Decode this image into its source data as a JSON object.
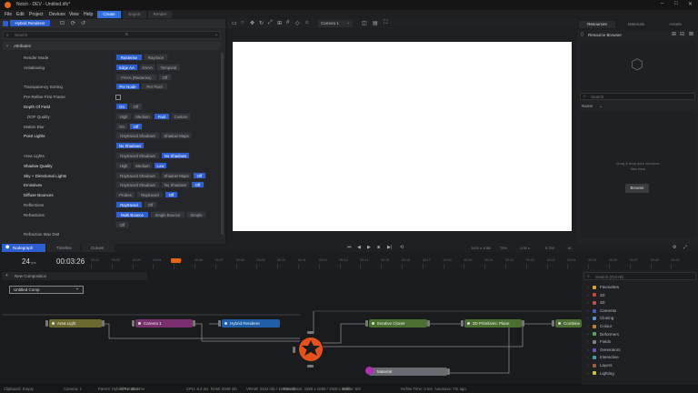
{
  "app": {
    "title": "Notch - DEV - Untitled.dfx*"
  },
  "menu": [
    "File",
    "Edit",
    "Project",
    "Devices",
    "View",
    "Help"
  ],
  "mode_tabs": [
    "Create",
    "Export",
    "Render"
  ],
  "left_panel": {
    "selector": "Hybrid Renderer",
    "search_placeholder": "Search",
    "section": "Attributes",
    "rows": [
      {
        "label": "Render Mode",
        "options": [
          "Rasterise",
          "Raytrace"
        ],
        "active": 0
      },
      {
        "label": "Antialiasing",
        "options": [
          "Edge AA",
          "SSAA",
          "Temporal"
        ],
        "active": 0
      },
      {
        "label": "",
        "options": [
          "FXAA (Rasterise)",
          "Off"
        ],
        "active": -1
      },
      {
        "label": "Transparency Sorting",
        "options": [
          "Per Node",
          "Per Pixel"
        ],
        "active": 0
      },
      {
        "label": "Pre-Refine First Frame",
        "options": [],
        "active": -1
      },
      {
        "label": "Depth Of Field",
        "options": [
          "On",
          "Off"
        ],
        "active": 0
      },
      {
        "label": "DOF Quality",
        "options": [
          "High",
          "Medium",
          "Fast",
          "Custom"
        ],
        "active": 2
      },
      {
        "label": "Motion Blur",
        "options": [
          "On",
          "Off"
        ],
        "active": 1
      },
      {
        "label": "Point Lights",
        "options": [
          "Raytraced Shadows",
          "Shadow Maps"
        ],
        "active": -1
      },
      {
        "label": "",
        "options": [
          "No Shadows"
        ],
        "active": 0
      },
      {
        "label": "Area Lights",
        "options": [
          "Raytraced Shadows",
          "No Shadows"
        ],
        "active": 1
      },
      {
        "label": "Shadow Quality",
        "options": [
          "High",
          "Medium",
          "Low"
        ],
        "active": 2
      },
      {
        "label": "Sky + Directional Lights",
        "options": [
          "Raytraced Shadows",
          "Shadow Maps",
          "Off"
        ],
        "active": 2
      },
      {
        "label": "Emissives",
        "options": [
          "Raytraced Shadows",
          "No Shadows",
          "Off"
        ],
        "active": 2
      },
      {
        "label": "Diffuse Bounces",
        "options": [
          "Probes",
          "Raytraced",
          "Off"
        ],
        "active": 2
      },
      {
        "label": "Reflections",
        "options": [
          "Raytraced",
          "Off"
        ],
        "active": 0
      },
      {
        "label": "Refractions",
        "options": [
          "Multi Bounce",
          "Single Bounce",
          "Simple"
        ],
        "active": 0
      },
      {
        "label": "",
        "options": [
          "Off"
        ],
        "active": -1
      },
      {
        "label": "Refraction Max Dist",
        "options": [],
        "active": -1
      }
    ]
  },
  "viewport": {
    "camera_label": "Camera 1"
  },
  "right_panel": {
    "tabs": [
      "Resources",
      "Materials",
      "Assets"
    ],
    "title": "Resource Browser",
    "search_placeholder": "Search",
    "column": "Name",
    "drop_hint": "Drag & drop your resource files here",
    "browse_button": "Browse"
  },
  "timeline_tabs": [
    "Nodegraph",
    "Timeline",
    "Curves"
  ],
  "transport": {
    "fps": "24",
    "fps_unit": "fps",
    "timecode": "00:03:26",
    "resolution": "1920 x 1080",
    "zoom_left": "75%",
    "zoom_right": "1.00 x",
    "speed": "1",
    "fps_right": "5.750",
    "fps_right2": "60"
  },
  "timeline_ticks": [
    "00:01",
    "00:02",
    "00:03",
    "00:04",
    "00:05",
    "00:06",
    "00:07",
    "00:08",
    "00:09",
    "00:10",
    "00:11",
    "00:12",
    "00:13",
    "00:14",
    "00:15",
    "00:16",
    "00:17",
    "00:18",
    "00:19",
    "00:20",
    "00:21",
    "00:22",
    "00:23",
    "00:24",
    "00:25",
    "00:26",
    "00:27",
    "00:28",
    "00:29"
  ],
  "graph": {
    "new_composition": "New Composition",
    "comp_name": "Untitled Comp",
    "nodes": [
      {
        "label": "Area Light",
        "color": "#6b6a2e"
      },
      {
        "label": "Camera 1",
        "color": "#7a2f6e"
      },
      {
        "label": "Hybrid Renderer",
        "color": "#1f5fa8"
      },
      {
        "label": "Iterative Cloner",
        "color": "#4a7030"
      },
      {
        "label": "3D Primitives: Plane",
        "color": "#4a7030"
      },
      {
        "label": "Combine",
        "color": "#4a7030"
      },
      {
        "label": "Material",
        "color": "#6a6b70"
      }
    ]
  },
  "library": {
    "search_placeholder": "Search (Ctrl+B)",
    "items": [
      "Favourites",
      "2D",
      "3D",
      "Cameras",
      "Cloning",
      "Colour",
      "Deformers",
      "Fields",
      "Generators",
      "Interactive",
      "Layers",
      "Lighting"
    ],
    "colors": [
      "#e0a030",
      "#d04040",
      "#c05050",
      "#4060c0",
      "#6090d0",
      "#c08030",
      "#60a060",
      "#808080",
      "#7050c0",
      "#40a0a0",
      "#a06040",
      "#d0c040"
    ]
  },
  "status": {
    "items": [
      "Clipboard: Empty",
      "Camera: 1",
      "Parent: Hybrid Renderer",
      "GPU: 32.2 ms",
      "CPU: 6.4 ms",
      "RAM: 2048 mb",
      "VRAM: 3424 mb / 16508 mb",
      "Resolution: 1920 x 1080 / 1920 x 1080",
      "Refine: 0/0",
      "Refine Time: 0 ms",
      "Autosave: 7m ago"
    ]
  }
}
